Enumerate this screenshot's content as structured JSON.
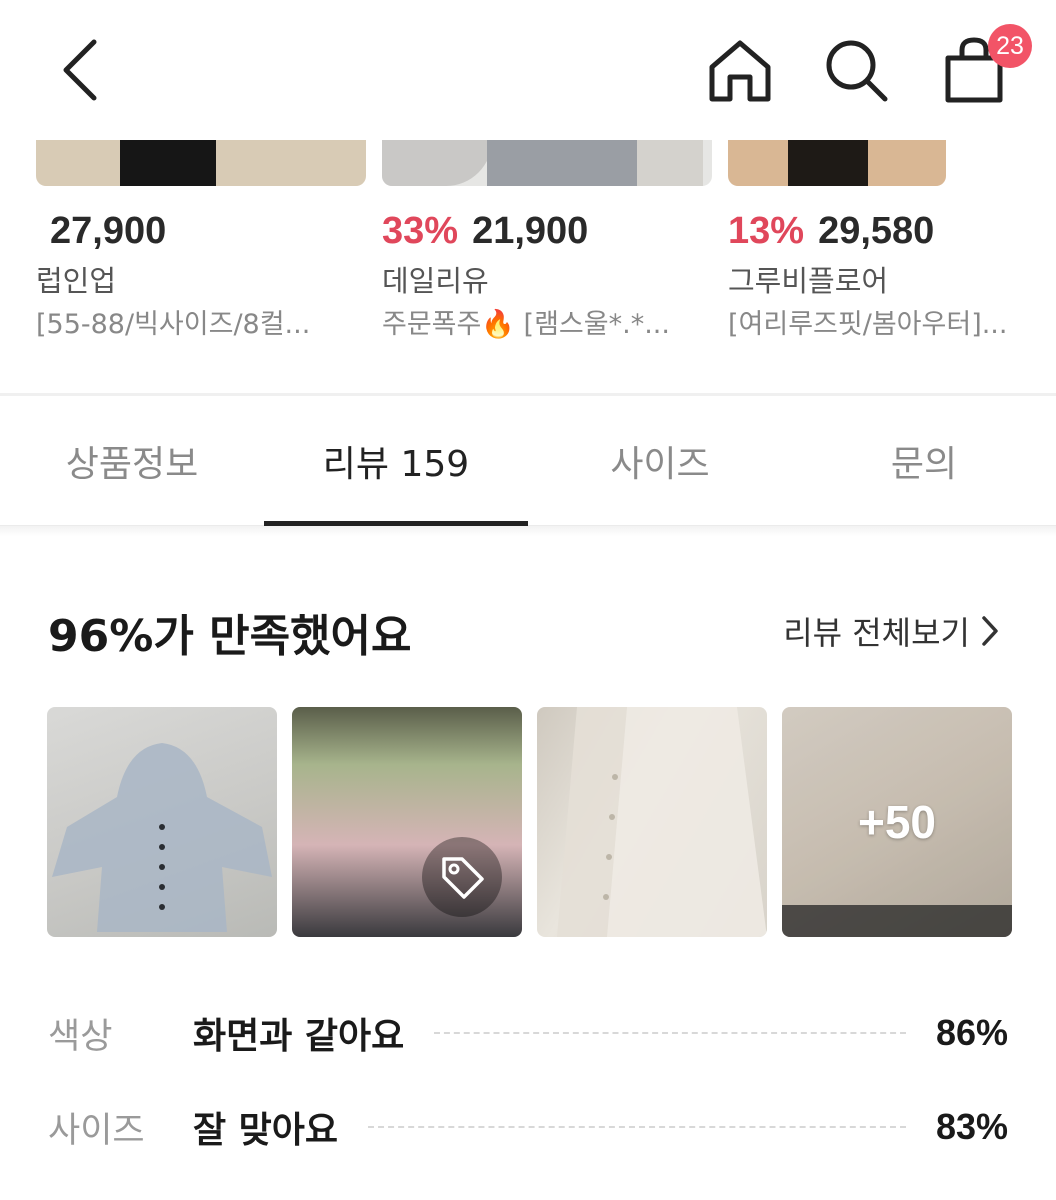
{
  "header": {
    "cart_count": "23"
  },
  "products": [
    {
      "discount": "",
      "price": "27,900",
      "brand": "럽인업",
      "desc": "[55-88/빅사이즈/8컬..."
    },
    {
      "discount": "33%",
      "price": "21,900",
      "brand": "데일리유",
      "desc": "주문폭주🔥 [램스울*.*..."
    },
    {
      "discount": "13%",
      "price": "29,580",
      "brand": "그루비플로어",
      "desc": "[여리루즈핏/봄아우터]..."
    }
  ],
  "tabs": [
    {
      "label": "상품정보",
      "active": false
    },
    {
      "label": "리뷰 159",
      "active": true
    },
    {
      "label": "사이즈",
      "active": false
    },
    {
      "label": "문의",
      "active": false
    }
  ],
  "review": {
    "title": "96%가 만족했어요",
    "view_all": "리뷰 전체보기",
    "more_count": "+50",
    "stats": [
      {
        "category": "색상",
        "value": "화면과 같아요",
        "percent": "86%"
      },
      {
        "category": "사이즈",
        "value": "잘 맞아요",
        "percent": "83%"
      }
    ]
  },
  "colors": {
    "accent_red": "#e0475b",
    "badge": "#f25467"
  },
  "icons": [
    "chevron-left-icon",
    "home-icon",
    "search-icon",
    "shopping-bag-icon",
    "tag-icon",
    "chevron-right-icon"
  ]
}
